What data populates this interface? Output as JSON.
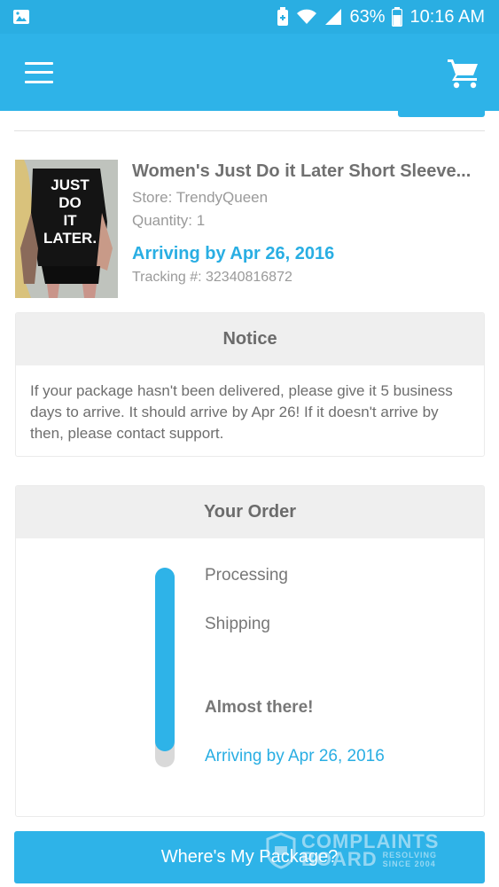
{
  "status_bar": {
    "battery_percent": "63%",
    "time": "10:16 AM"
  },
  "product": {
    "title": "Women's Just Do it Later Short Sleeve...",
    "store": "Store: TrendyQueen",
    "quantity": "Quantity: 1",
    "arriving": "Arriving by Apr 26, 2016",
    "tracking": "Tracking #: 32340816872",
    "image_text": [
      "JUST",
      "DO",
      "IT",
      "LATER."
    ]
  },
  "notice": {
    "heading": "Notice",
    "body": "If your package hasn't been delivered, please give it 5 business days to arrive. It should arrive by Apr 26! If it doesn't arrive by then, please contact support."
  },
  "order": {
    "heading": "Your Order",
    "progress_fraction": 0.92,
    "steps": [
      {
        "label": "Processing"
      },
      {
        "label": "Shipping"
      },
      {
        "label": "Almost there!"
      },
      {
        "label": "Arriving by Apr 26, 2016"
      }
    ]
  },
  "cta": {
    "label": "Where's My Package?"
  },
  "watermark": {
    "line1": "COMPLAINTS",
    "line2": "BOARD",
    "tag1": "RESOLVING",
    "tag2": "SINCE 2004"
  },
  "colors": {
    "accent": "#2eb3e8",
    "text_link": "#29aee3",
    "card_header": "#efefef"
  },
  "icons": [
    "image-icon",
    "battery-saver-icon",
    "wifi-icon",
    "signal-icon",
    "battery-icon",
    "menu-icon",
    "cart-icon"
  ]
}
